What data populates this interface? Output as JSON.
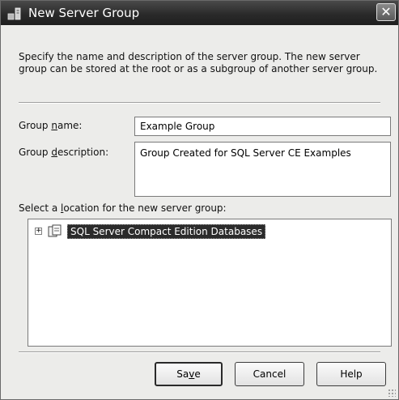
{
  "window": {
    "title": "New Server Group",
    "close_glyph": "✕",
    "icon": "server-group-icon"
  },
  "description": "Specify the name and description of the server group. The new server group can be stored at the root or as a subgroup of another server group.",
  "group_name": {
    "label_prefix": "Group ",
    "label_accel": "n",
    "label_suffix": "ame:",
    "value": "Example Group"
  },
  "group_description": {
    "label_prefix": "Group ",
    "label_accel": "d",
    "label_suffix": "escription:",
    "value": "Group Created for SQL Server CE Examples"
  },
  "location": {
    "label_prefix": "Select a ",
    "label_accel": "l",
    "label_suffix": "ocation for the new server group:",
    "tree": [
      {
        "label": "SQL Server Compact Edition Databases",
        "expander": "+",
        "icon": "server-group-node-icon",
        "selected": true
      }
    ]
  },
  "buttons": {
    "save_prefix": "Sa",
    "save_accel": "v",
    "save_suffix": "e",
    "cancel": "Cancel",
    "help": "Help"
  },
  "colors": {
    "titlebar": "#2a2a2a",
    "dialog_bg": "#ececea",
    "selection": "#2b2b2b"
  }
}
